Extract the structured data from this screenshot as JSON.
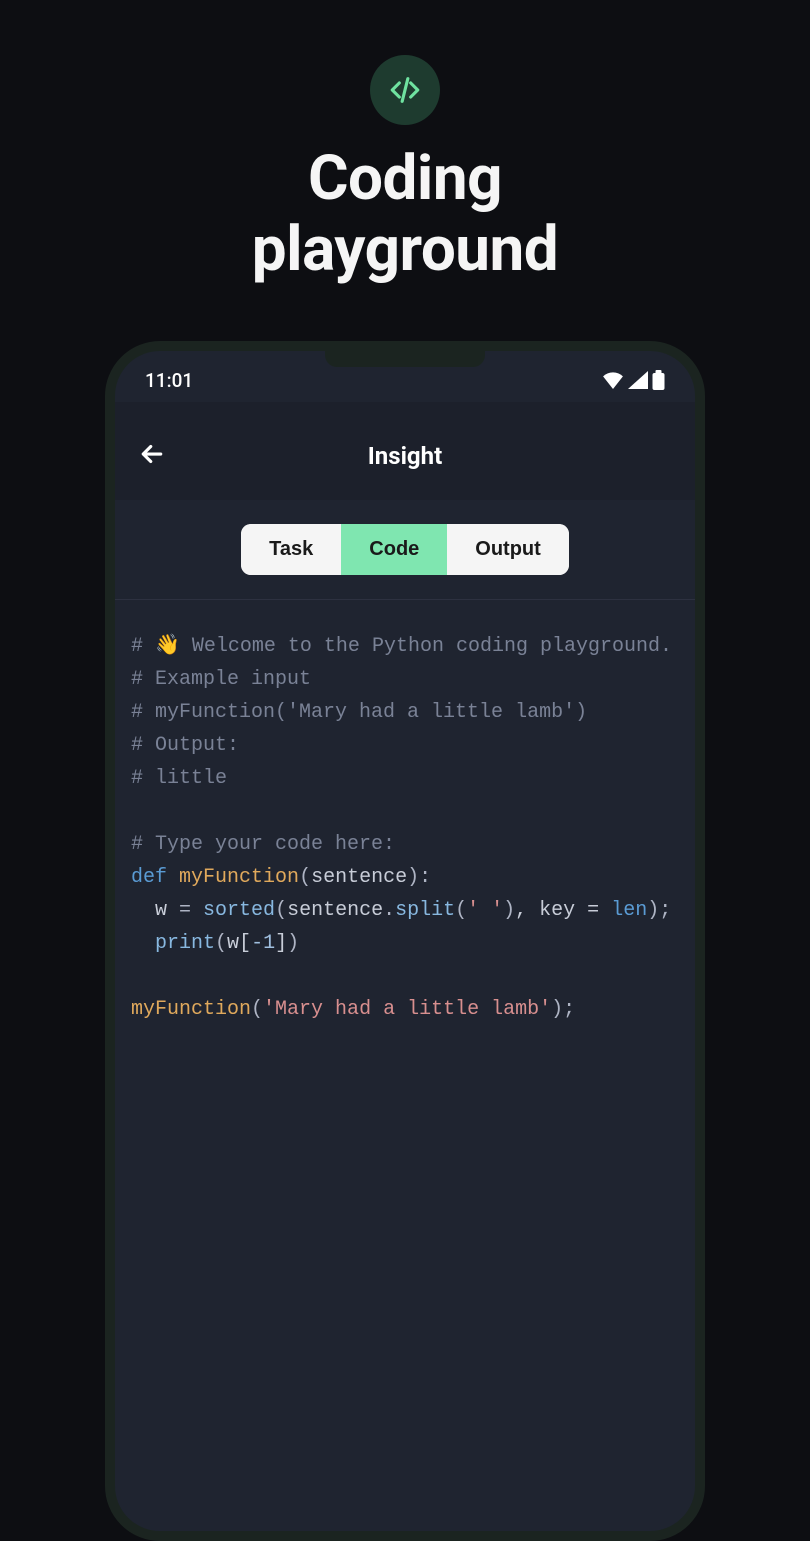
{
  "promo": {
    "title_line1": "Coding",
    "title_line2": "playground"
  },
  "status_bar": {
    "time": "11:01"
  },
  "header": {
    "title": "Insight"
  },
  "tabs": {
    "task": "Task",
    "code": "Code",
    "output": "Output",
    "active": "code"
  },
  "code": {
    "c1": "# 👋 Welcome to the Python coding playground.",
    "c2": "# Example input",
    "c3": "# myFunction('Mary had a little lamb')",
    "c4": "# Output:",
    "c5": "# little",
    "c6": "# Type your code here:",
    "kw_def": "def",
    "fn_def_name": "myFunction",
    "param": "sentence",
    "assign_lhs": "w",
    "op_eq": " = ",
    "sorted_call": "sorted",
    "split_call": "split",
    "split_arg": "' '",
    "key_kw": ", key = ",
    "len_ident": "len",
    "print_call": "print",
    "idx_expr_open": "w[",
    "idx_num": "-1",
    "idx_expr_close": "]",
    "call_fn": "myFunction",
    "call_arg": "'Mary had a little lamb'",
    "lparen": "(",
    "rparen": ")",
    "colon": ":",
    "dot": ".",
    "semi": ";",
    "indent": "  "
  }
}
